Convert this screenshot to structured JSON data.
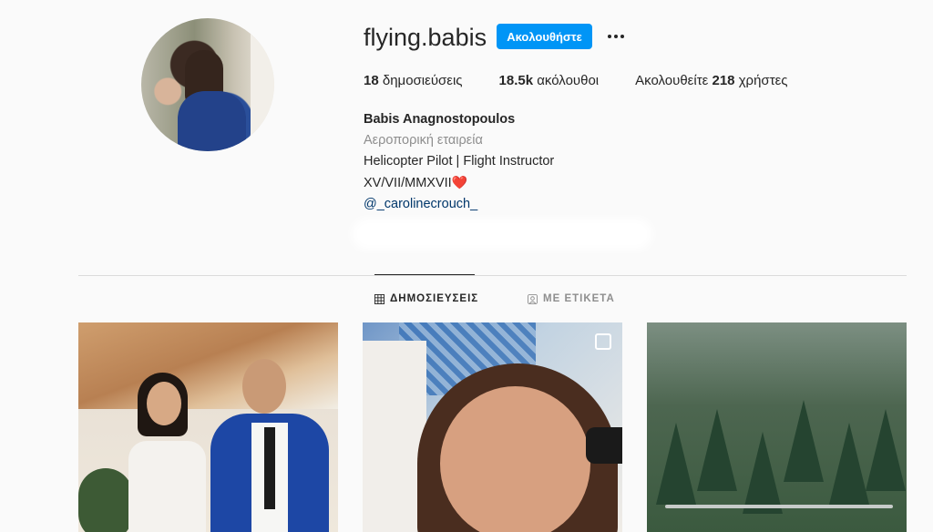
{
  "profile": {
    "username": "flying.babis",
    "follow_label": "Ακολουθήστε",
    "stats": {
      "posts_count": "18",
      "posts_label": "δημοσιεύσεις",
      "followers_count": "18.5k",
      "followers_label": "ακόλουθοι",
      "following_prefix": "Ακολουθείτε",
      "following_count": "218",
      "following_suffix": "χρήστες"
    },
    "bio": {
      "name": "Babis Anagnostopoulos",
      "category": "Αεροπορική εταιρεία",
      "line1": "Helicopter Pilot | Flight Instructor",
      "line2": "XV/VII/MMXVII",
      "line2_emoji": "❤️",
      "mention": "@_carolinecrouch_"
    }
  },
  "tabs": [
    {
      "label": "ΔΗΜΟΣΙΕΥΣΕΙΣ",
      "icon": "grid-icon",
      "active": true
    },
    {
      "label": "ΜΕ ΕΤΙΚΕΤΑ",
      "icon": "tagged-icon",
      "active": false
    }
  ],
  "colors": {
    "accent": "#0095f6",
    "background": "#fafafa",
    "text": "#262626",
    "muted": "#8e8e8e",
    "link": "#00376b"
  }
}
